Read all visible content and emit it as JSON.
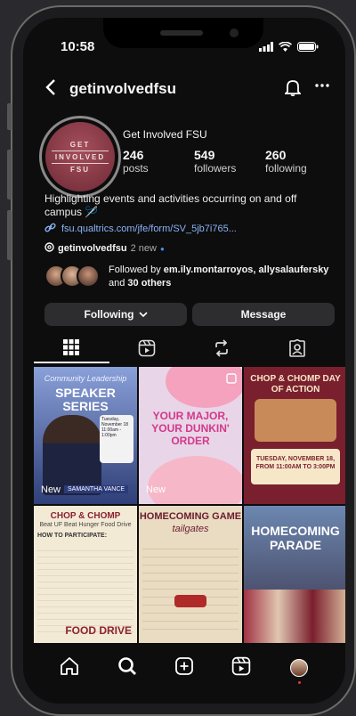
{
  "status_bar": {
    "time": "10:58"
  },
  "header": {
    "username": "getinvolvedfsu"
  },
  "profile": {
    "avatar_text": [
      "GET",
      "INVOLVED",
      "FSU"
    ],
    "name": "Get Involved FSU",
    "stats": [
      {
        "value": "246",
        "label": "posts"
      },
      {
        "value": "549",
        "label": "followers"
      },
      {
        "value": "260",
        "label": "following"
      }
    ],
    "bio": "Highlighting events and activities occurring on and off campus 🪡",
    "link": "fsu.qualtrics.com/jfe/form/SV_5jb7i765...",
    "threads": {
      "handle": "getinvolvedfsu",
      "new_text": "2 new"
    },
    "followed_by": {
      "prefix": "Followed by ",
      "names": "em.ily.montarroyos, allysalaufersky",
      "middle": " and ",
      "others": "30 others"
    }
  },
  "actions": {
    "following_label": "Following",
    "message_label": "Message"
  },
  "posts": [
    {
      "line1": "Community Leadership",
      "line2": "SPEAKER SERIES",
      "card": "Tuesday, November 18 11:00am - 1:00pm",
      "name": "SAMANTHA VANCE",
      "badge": "New"
    },
    {
      "line1": "YOUR MAJOR, YOUR DUNKIN' ORDER",
      "badge": "New"
    },
    {
      "line1": "CHOP & CHOMP DAY OF ACTION",
      "line2": "TUESDAY, NOVEMBER 18, FROM 11:00AM TO 3:00PM"
    },
    {
      "line1": "CHOP & CHOMP",
      "line2": "Beat UF Beat Hunger Food Drive",
      "line3": "HOW TO PARTICIPATE:",
      "line4": "FOOD DRIVE"
    },
    {
      "line1": "HOMECOMING GAME",
      "line2": "tailgates"
    },
    {
      "line1": "HOMECOMING PARADE"
    }
  ],
  "colors": {
    "link": "#8ab4f8",
    "background": "#0d0d0d",
    "button": "#2d2d30"
  }
}
